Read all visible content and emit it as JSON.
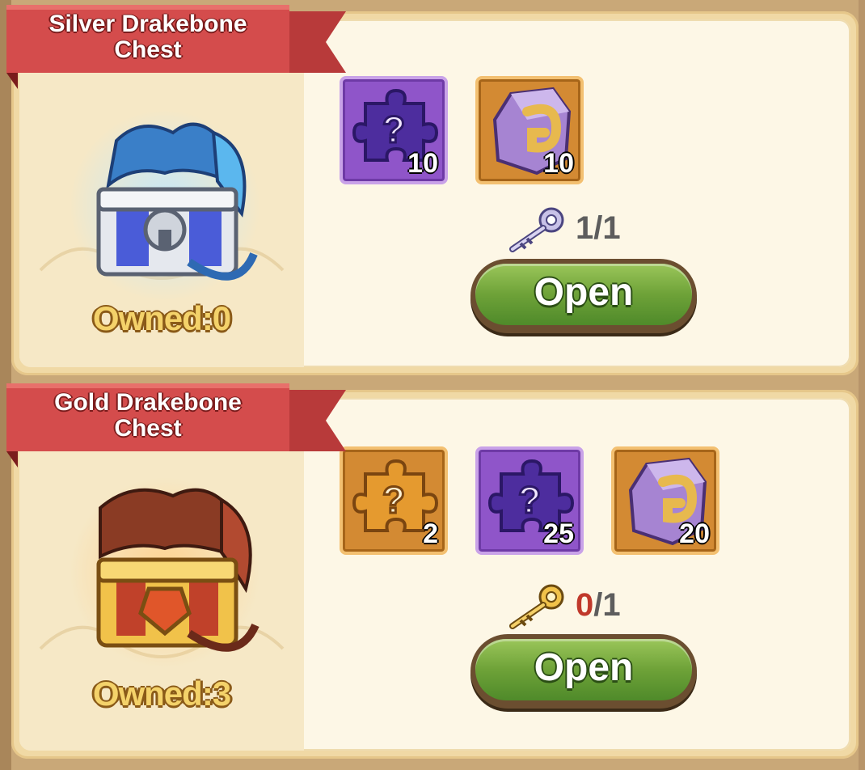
{
  "chests": [
    {
      "title_line1": "Silver Drakebone",
      "title_line2": "Chest",
      "owned_label": "Owned:0",
      "rewards": [
        {
          "icon": "purple-mystery-puzzle-icon",
          "qty": "10"
        },
        {
          "icon": "purple-rune-stone-icon",
          "qty": "10"
        }
      ],
      "key_icon": "silver-key-icon",
      "key_have": "1",
      "key_sep_need": "/1",
      "open_label": "Open"
    },
    {
      "title_line1": "Gold Drakebone",
      "title_line2": "Chest",
      "owned_label": "Owned:3",
      "rewards": [
        {
          "icon": "orange-mystery-puzzle-icon",
          "qty": "2"
        },
        {
          "icon": "purple-mystery-puzzle-icon",
          "qty": "25"
        },
        {
          "icon": "purple-rune-stone-icon",
          "qty": "20"
        }
      ],
      "key_icon": "gold-key-icon",
      "key_have": "0",
      "key_sep_need": "/1",
      "open_label": "Open"
    }
  ],
  "colors": {
    "ribbon": "#d44c4c",
    "button_green": "#6ea238",
    "owned_text": "#f4d26a",
    "insufficient": "#c0392b"
  }
}
